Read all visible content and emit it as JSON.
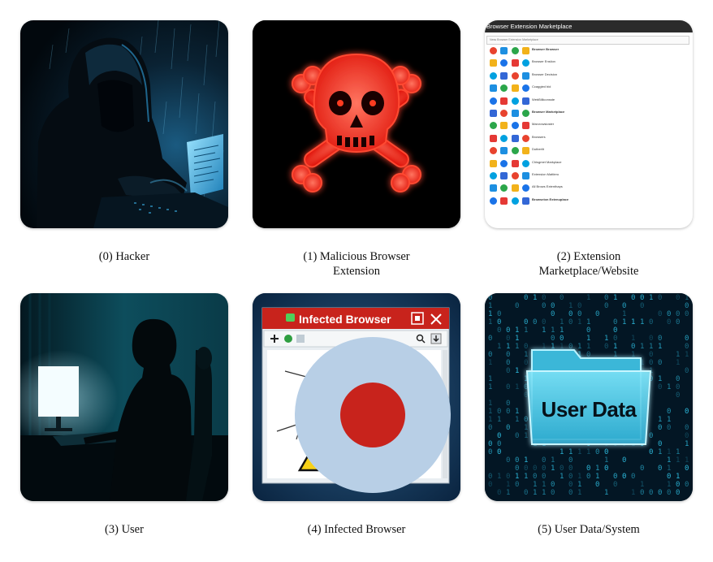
{
  "nodes": [
    {
      "index": "(0)",
      "label": "Hacker"
    },
    {
      "index": "(1)",
      "label": "Malicious Browser Extension"
    },
    {
      "index": "(2)",
      "label": "Extension Marketplace/Website"
    },
    {
      "index": "(3)",
      "label": "User"
    },
    {
      "index": "(4)",
      "label": "Infected Browser"
    },
    {
      "index": "(5)",
      "label": "User Data/System"
    }
  ],
  "captions": {
    "n0": "(0) Hacker",
    "n1_line1": "(1) Malicious Browser",
    "n1_line2": "Extension",
    "n2_line1": "(2) Extension",
    "n2_line2": "Marketplace/Website",
    "n3": "(3) User",
    "n4": "(4) Infected Browser",
    "n5": "(5) User Data/System"
  },
  "marketplace": {
    "window_title": "Browser Extension Marketplace",
    "search_text": "Ness    Browser Extension Marketplace",
    "rows": [
      "Browser Browser",
      "Browser Ensiion",
      "Browser Decision",
      "Ccaggied bid",
      "WebBilliconsste",
      "Browser Marketplace",
      "Marcrowsioster",
      "Browsers",
      "Dutberlit",
      "Chisgmet Markplace",
      "Extension Mattlero",
      "All Brows Extenthaps",
      "Browseion Extenuplace"
    ]
  },
  "infected_browser": {
    "title": "Infected Browser"
  },
  "user_data": {
    "folder_label": "User Data"
  },
  "colors": {
    "hacker_glow": "#1e9bd7",
    "skull_red": "#ff2a1a",
    "browser_titlebar": "#c8231c",
    "warning_yellow": "#f7d117",
    "data_cyan": "#2fc4e8"
  }
}
